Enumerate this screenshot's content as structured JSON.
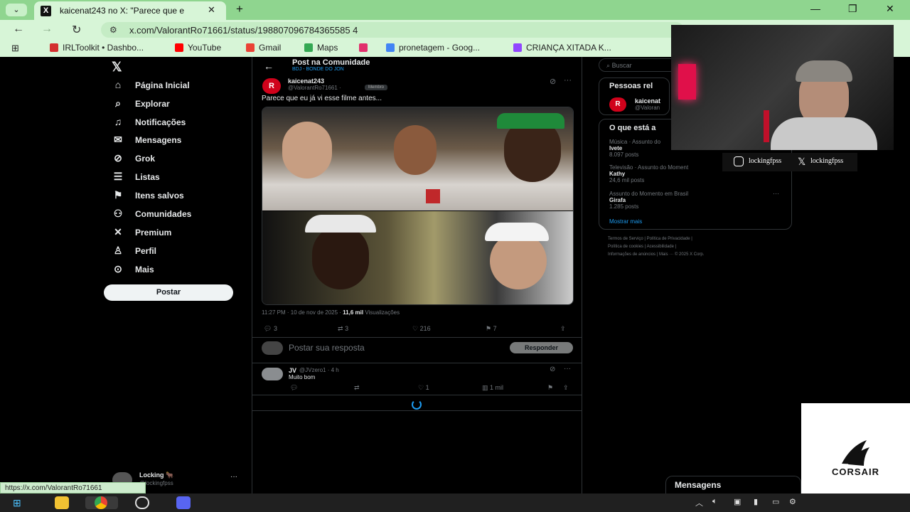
{
  "browser": {
    "tab_title": "kaicenat243 no X: \"Parece que e",
    "tab_close": "✕",
    "new_tab": "+",
    "url": "x.com/ValorantRo71661/status/198807096784365585 4",
    "bookmarks": [
      {
        "label": "IRLToolkit • Dashbo...",
        "color": "#d32f2f"
      },
      {
        "label": "YouTube",
        "color": "#ff0000"
      },
      {
        "label": "Gmail",
        "color": "#ea4335"
      },
      {
        "label": "Maps",
        "color": "#34a853"
      },
      {
        "label": "",
        "color": "#e1306c"
      },
      {
        "label": "pronetagem - Goog...",
        "color": "#4285f4"
      },
      {
        "label": "CRIANÇA XITADA K...",
        "color": "#9146ff"
      }
    ],
    "status_url": "https://x.com/ValorantRo71661"
  },
  "sidebar": {
    "items": [
      {
        "label": "Página Inicial",
        "icon": "⌂"
      },
      {
        "label": "Explorar",
        "icon": "⌕"
      },
      {
        "label": "Notificações",
        "icon": "🔔"
      },
      {
        "label": "Mensagens",
        "icon": "✉"
      },
      {
        "label": "Grok",
        "icon": "⊘"
      },
      {
        "label": "Listas",
        "icon": "☰"
      },
      {
        "label": "Itens salvos",
        "icon": "⚑"
      },
      {
        "label": "Comunidades",
        "icon": "⚇"
      },
      {
        "label": "Premium",
        "icon": "✕"
      },
      {
        "label": "Perfil",
        "icon": "♙"
      },
      {
        "label": "Mais",
        "icon": "⋯"
      }
    ],
    "post_button": "Postar",
    "account_name": "Locking 🐂",
    "account_handle": "@lockingfpss",
    "account_more": "···"
  },
  "post": {
    "header_title": "Post na Comunidade",
    "community": "BDJ - BONDE DO JON",
    "author_name": "kaicenat243",
    "author_handle": "@ValorantRo71661 ·",
    "member_badge": "Membro",
    "avatar_letter": "R",
    "text": "Parece que eu já vi esse filme antes...",
    "time_prefix": "11:27 PM · 10 de nov de 2025 ·",
    "views_count": "11,6 mil",
    "views_label": "Visualizações",
    "replies": "3",
    "reposts": "3",
    "likes": "216",
    "bookmarks": "7",
    "reply_placeholder": "Postar sua resposta",
    "reply_button": "Responder"
  },
  "reply": {
    "name": "JV",
    "handle": "@JVzero1 · 4 h",
    "text": "Muito bom",
    "likes": "1",
    "views": "1 mil"
  },
  "right": {
    "search_placeholder": "Buscar",
    "people_title": "Pessoas rel",
    "person_name": "kaicenat",
    "person_handle": "@Valoran",
    "trends_title": "O que está a",
    "trends": [
      {
        "meta": "Música · Assunto do",
        "name": "Ivete",
        "count": "8.097 posts"
      },
      {
        "meta": "Televisão · Assunto do Moment",
        "name": "Kathy",
        "count": "24,6 mil posts"
      },
      {
        "meta": "Assunto do Momento em Brasil",
        "name": "Girafa",
        "count": "1.285 posts"
      }
    ],
    "show_more": "Mostrar mais",
    "footer_links": [
      "Termos de Serviço",
      "Política de Privacidade",
      "Política de cookies",
      "Acessibilidade",
      "Informações de anúncios",
      "Mais ···",
      "© 2025 X Corp."
    ]
  },
  "webcam": {
    "instagram": "lockingfpss",
    "x_handle": "lockingfpss"
  },
  "messages_drawer": "Mensagens",
  "sponsor": "CORSAIR"
}
